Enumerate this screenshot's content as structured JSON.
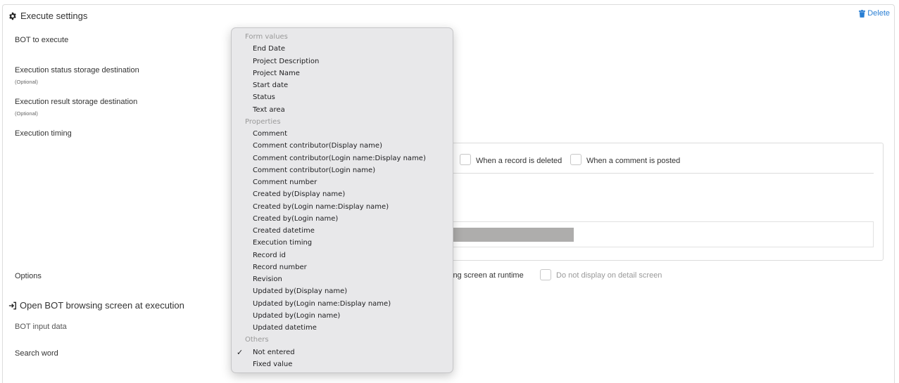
{
  "header": {
    "title": "Execute settings",
    "delete_label": "Delete"
  },
  "labels": {
    "bot_to_execute": "BOT to execute",
    "status_storage": "Execution status storage destination",
    "status_storage_optional": "(Optional)",
    "result_storage": "Execution result storage destination",
    "result_storage_optional": "(Optional)",
    "execution_timing": "Execution timing",
    "options": "Options",
    "open_bot": "Open BOT browsing screen at execution",
    "bot_input_data": "BOT input data",
    "search_word": "Search word"
  },
  "timing": {
    "record_deleted": "When a record is deleted",
    "comment_posted": "When a comment is posted",
    "progress_fraction": 0.29
  },
  "options": {
    "browsing_partial": "vsing screen at runtime",
    "no_detail": "Do not display on detail screen"
  },
  "dropdown": {
    "groups": [
      {
        "label": "Form values",
        "items": [
          "End Date",
          "Project Description",
          "Project Name",
          "Start date",
          "Status",
          "Text area"
        ]
      },
      {
        "label": "Properties",
        "items": [
          "Comment",
          "Comment contributor(Display name)",
          "Comment contributor(Login name:Display name)",
          "Comment contributor(Login name)",
          "Comment number",
          "Created by(Display name)",
          "Created by(Login name:Display name)",
          "Created by(Login name)",
          "Created datetime",
          "Execution timing",
          "Record id",
          "Record number",
          "Revision",
          "Updated by(Display name)",
          "Updated by(Login name:Display name)",
          "Updated by(Login name)",
          "Updated datetime"
        ]
      },
      {
        "label": "Others",
        "items": [
          "Not entered",
          "Fixed value"
        ]
      }
    ],
    "selected": "Not entered",
    "check_mark": "✓"
  },
  "colors": {
    "link": "#2a7fd4",
    "progress": "#aeadac",
    "menu_bg": "#e8e8ea"
  }
}
